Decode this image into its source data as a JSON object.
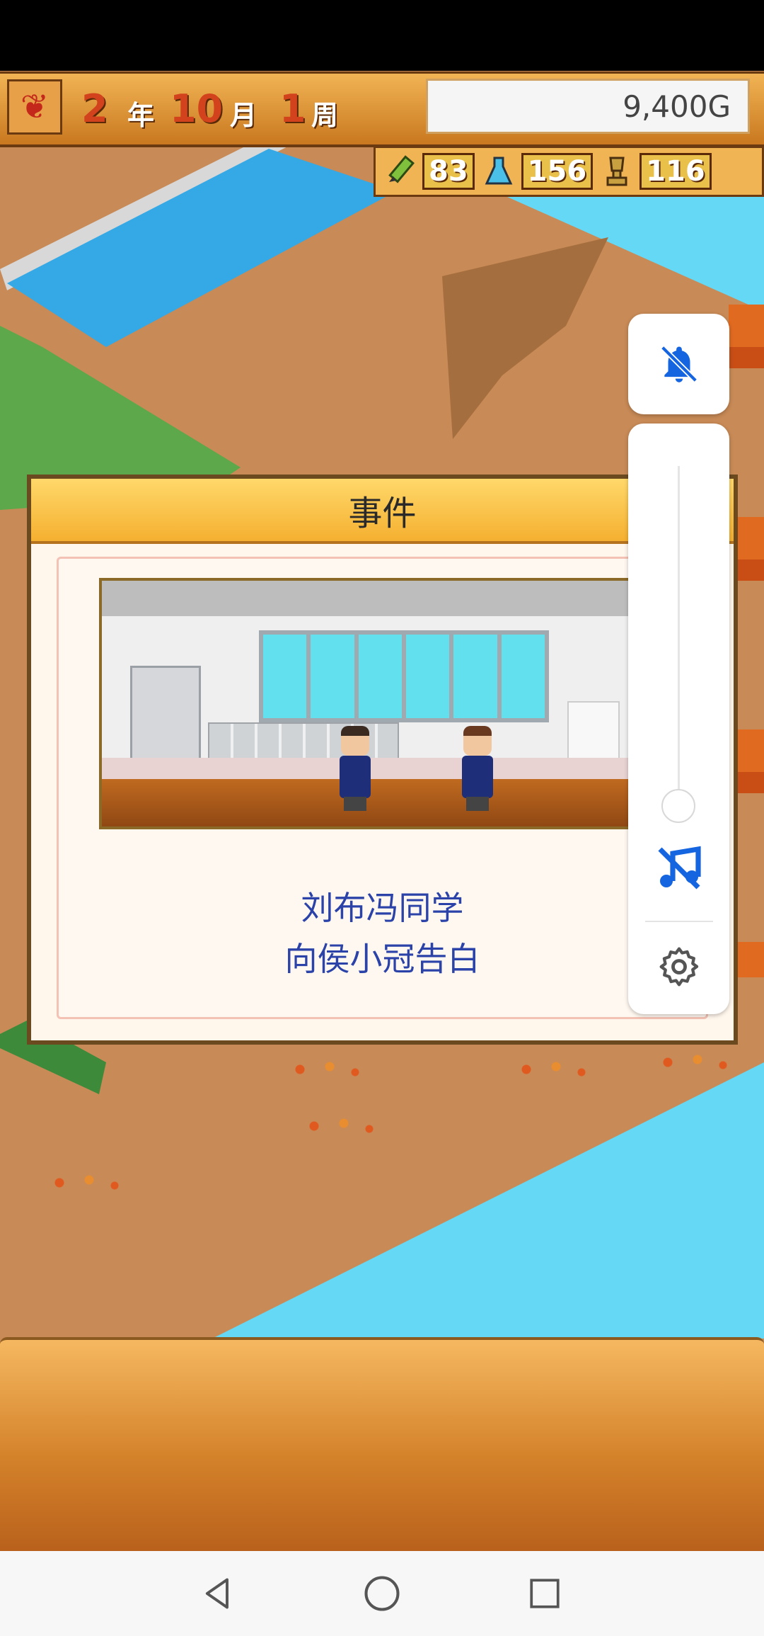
{
  "hud": {
    "year_value": "2",
    "year_unit": "年",
    "month_value": "10",
    "month_unit": "月",
    "week_value": "1",
    "week_unit": "周",
    "money": "9,400G",
    "season_icon": "maple-leaf-icon"
  },
  "stats": [
    {
      "icon": "pencil-icon",
      "value": "83"
    },
    {
      "icon": "flask-icon",
      "value": "156"
    },
    {
      "icon": "trophy-icon",
      "value": "116"
    }
  ],
  "dialog": {
    "title": "事件",
    "line1": "刘布冯同学",
    "line2": "向侯小冠告白"
  },
  "volume_panel": {
    "icons": [
      "bell-muted-icon",
      "music-muted-icon",
      "gear-icon"
    ],
    "accent": "#1565e0"
  },
  "nav": {
    "buttons": [
      "back-icon",
      "home-icon",
      "recents-icon"
    ]
  }
}
